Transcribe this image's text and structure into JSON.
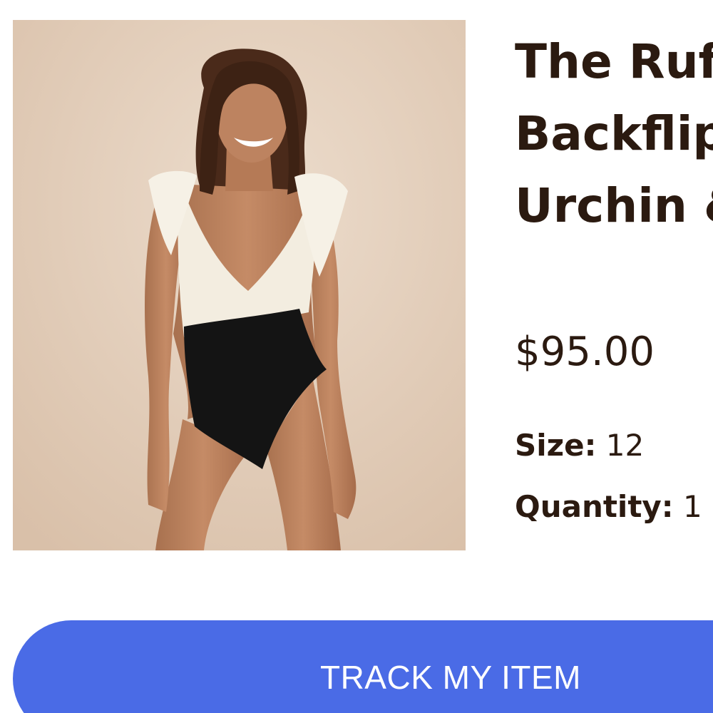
{
  "product": {
    "image_alt": "Woman wearing ruffle-shoulder one-piece swimsuit, cream top and black bottom",
    "title": "The Ruffle Backflip - Urchin & Sand*",
    "price": "$95.00",
    "size_label": "Size:",
    "size_value": "12",
    "quantity_label": "Quantity:",
    "quantity_value": "1"
  },
  "actions": {
    "track_label": "TRACK MY ITEM"
  },
  "colors": {
    "text": "#2b1a10",
    "button": "#4a6be6",
    "button_text": "#ffffff",
    "photo_background": "#e3cdb9"
  }
}
